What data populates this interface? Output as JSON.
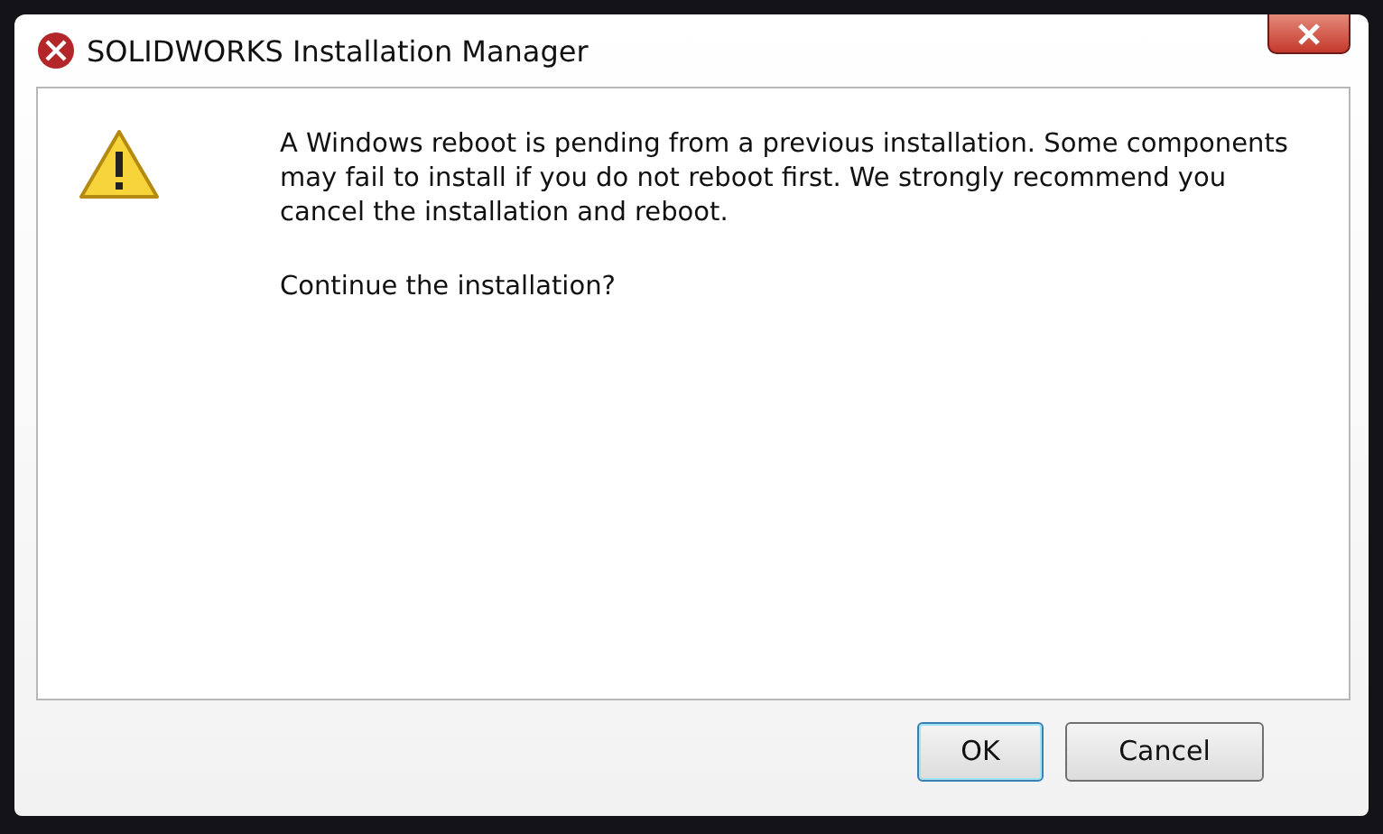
{
  "window": {
    "title": "SOLIDWORKS Installation Manager"
  },
  "message": {
    "kind": "warning",
    "text": "A Windows reboot is pending from a previous installation. Some components may fail to install if you do not reboot first. We strongly recommend you cancel the installation and reboot.",
    "question": "Continue the installation?"
  },
  "buttons": [
    {
      "label": "OK",
      "default": true
    },
    {
      "label": "Cancel",
      "default": false
    }
  ]
}
